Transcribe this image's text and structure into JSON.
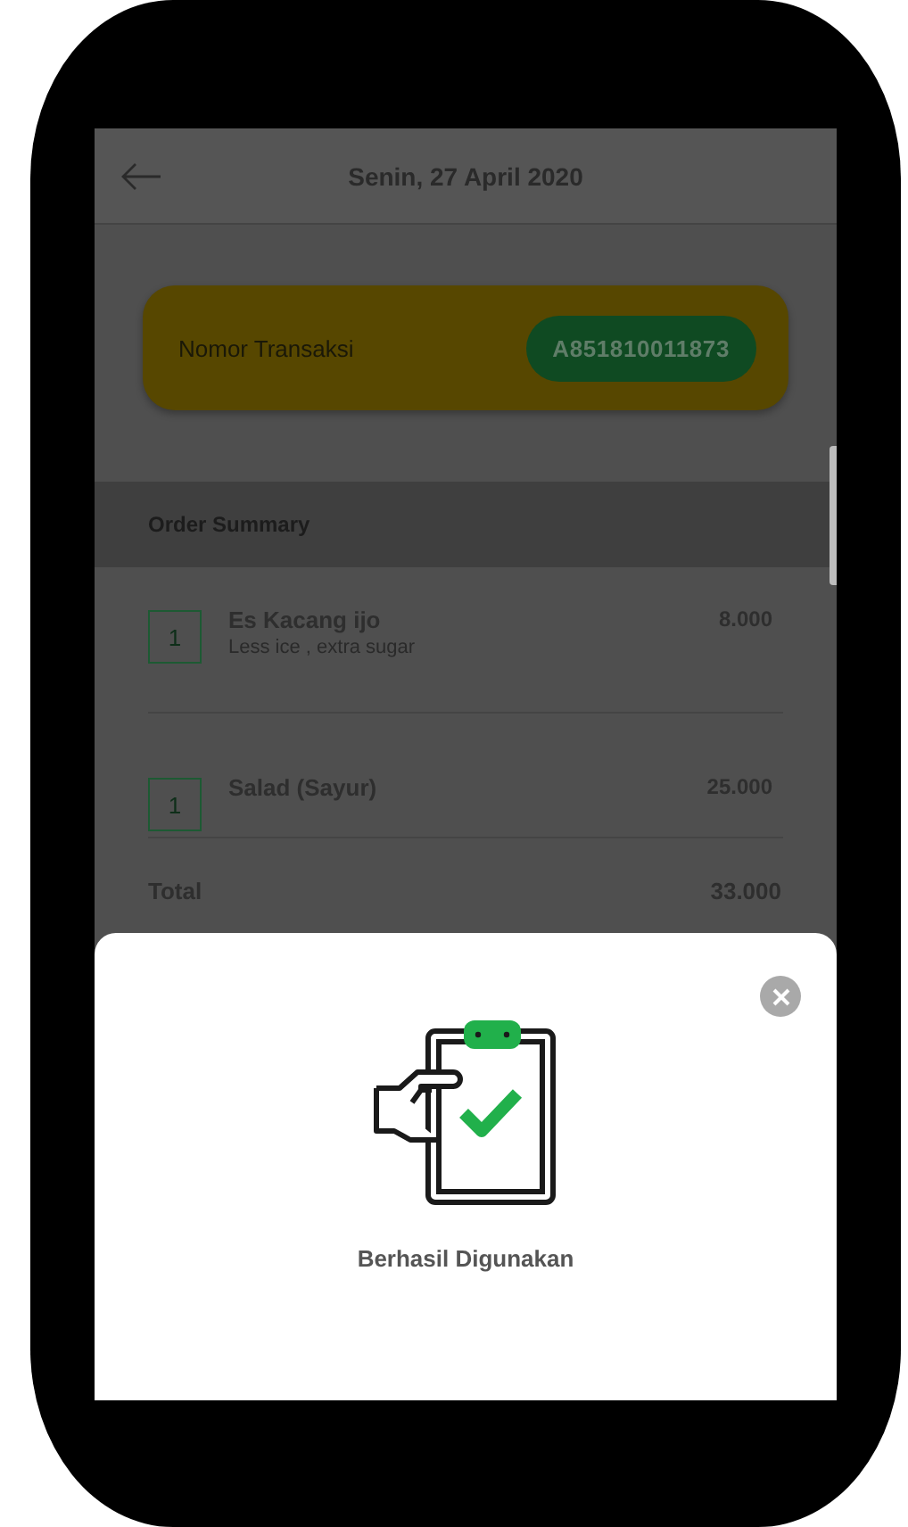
{
  "header": {
    "title": "Senin, 27 April 2020"
  },
  "transaction": {
    "label": "Nomor Transaksi",
    "number": "A851810011873"
  },
  "order_summary": {
    "heading": "Order Summary",
    "items": [
      {
        "quantity": "1",
        "name": "Es Kacang ijo",
        "note": "Less ice , extra sugar",
        "price": "8.000"
      },
      {
        "quantity": "1",
        "name": "Salad (Sayur)",
        "price": "25.000"
      }
    ],
    "total_label": "Total",
    "total": "33.000"
  },
  "dialog": {
    "message": "Berhasil Digunakan"
  }
}
